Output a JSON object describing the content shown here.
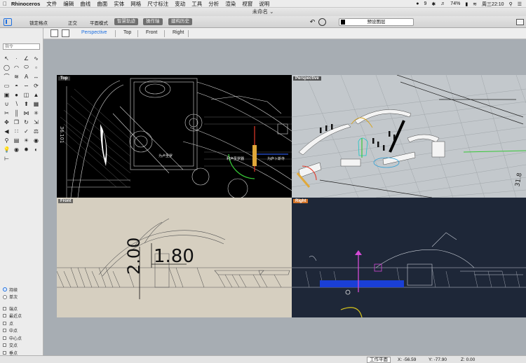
{
  "menubar": {
    "app_name": "Rhinoceros",
    "items": [
      "文件",
      "编辑",
      "曲线",
      "曲面",
      "实体",
      "网格",
      "尺寸标注",
      "变动",
      "工具",
      "分析",
      "渲染",
      "视窗",
      "说明"
    ],
    "right": {
      "badge": "9",
      "battery": "74%",
      "time": "周三22:10"
    }
  },
  "window": {
    "title": "未命名"
  },
  "toolbar": {
    "osnap_label": "锁定格点",
    "ortho_label": "正交",
    "planar_label": "平面模式",
    "smarttrack_label": "智慧轨迹",
    "gumball_label": "操作轴",
    "history_label": "建构历史",
    "layer_name": "预设图层"
  },
  "viewport_tabs": [
    "Perspective",
    "Top",
    "Front",
    "Right"
  ],
  "command": {
    "placeholder": "指令"
  },
  "viewports": {
    "top": "Top",
    "perspective": "Perspective",
    "front": "Front",
    "right": "Right"
  },
  "annotations": {
    "front_dim_1": "1.80",
    "front_dim_2": "2.00",
    "top_side_label": "36.101",
    "persp_label": "31.8"
  },
  "snaps": {
    "persistent": "持续",
    "oneshot": "单次",
    "items": [
      "端点",
      "最近点",
      "点",
      "中点",
      "中心点",
      "交点",
      "垂点",
      "切点"
    ]
  },
  "status": {
    "cplane": "工作平面",
    "x": "X: -56.59",
    "y": "Y: -77.90",
    "z": "Z: 0.00"
  },
  "colors": {
    "accent": "#1d6fe0",
    "right_label": "#d4752a",
    "front_bg": "#d6cfc0",
    "right_bg": "#1e2738",
    "persp_bg": "#c3c8cc"
  }
}
